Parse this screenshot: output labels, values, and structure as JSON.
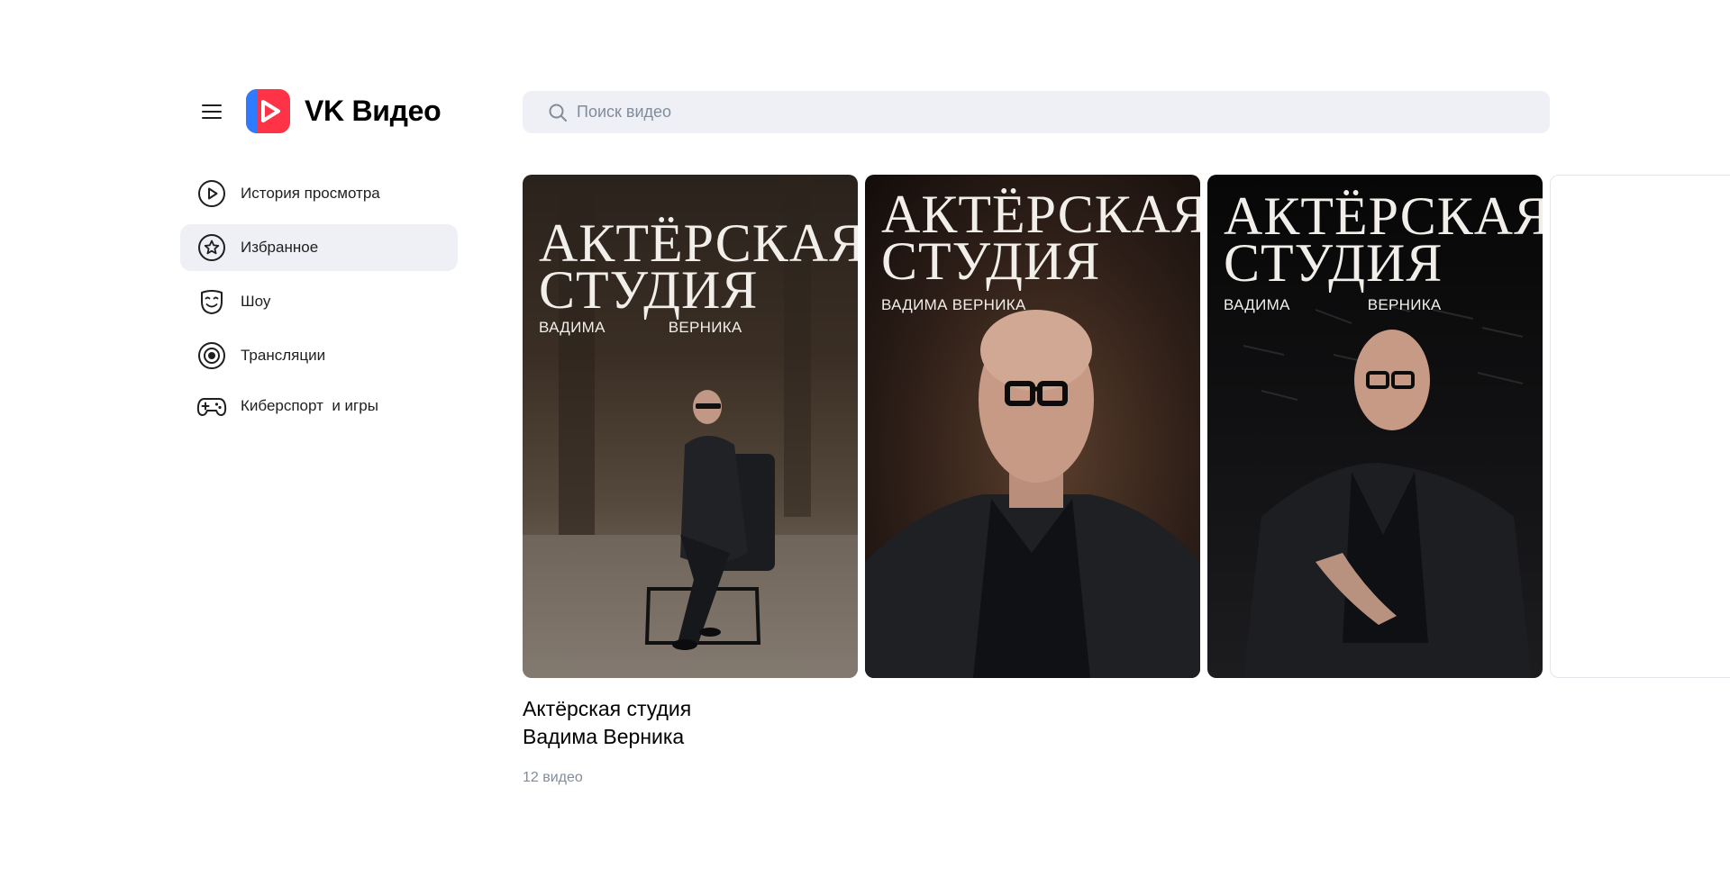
{
  "header": {
    "menu_icon": "hamburger-icon",
    "logo_text": "VK Видео",
    "logo_colors": {
      "red": "#ff3347",
      "blue": "#2f7bff"
    }
  },
  "search": {
    "placeholder": "Поиск видео",
    "icon": "search-icon"
  },
  "sidebar": {
    "items": [
      {
        "label": "История просмотра",
        "icon": "play-circle-icon",
        "active": false
      },
      {
        "label": "Избранное",
        "icon": "star-circle-icon",
        "active": true
      },
      {
        "label": "Шоу",
        "icon": "mask-icon",
        "active": false
      },
      {
        "label": "Трансляции",
        "icon": "broadcast-icon",
        "active": false
      },
      {
        "label": "Киберспорт  и игры",
        "icon": "gamepad-icon",
        "active": false
      }
    ]
  },
  "cards": [
    {
      "title": "АКТЁРСКАЯ\nСТУДИЯ",
      "subtitle_left": "ВАДИМА",
      "subtitle_right": "ВЕРНИКА"
    },
    {
      "title": "АКТЁРСКАЯ\nСТУДИЯ",
      "subtitle": "ВАДИМА ВЕРНИКА"
    },
    {
      "title": "АКТЁРСКАЯ\nСТУДИЯ",
      "subtitle_left": "ВАДИМА",
      "subtitle_right": "ВЕРНИКА"
    }
  ],
  "show": {
    "title": "Актёрская студия\nВадима Верника",
    "count": "12 видео"
  },
  "colors": {
    "active_bg": "#eef0f6",
    "search_bg": "#eef0f6",
    "muted_text": "#818c99"
  }
}
